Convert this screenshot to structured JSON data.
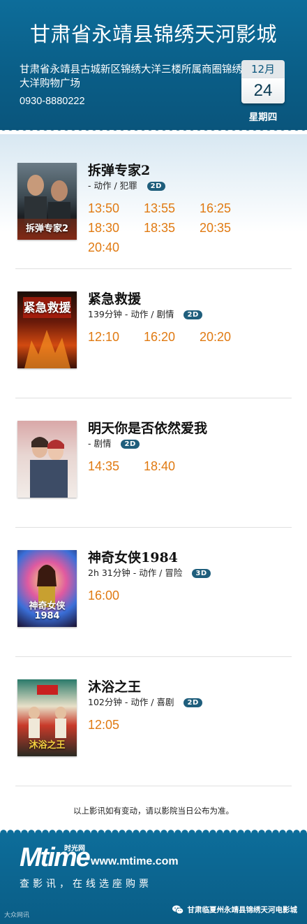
{
  "header": {
    "cinema_name": "甘肃省永靖县锦绣天河影城",
    "address": "甘肃省永靖县古城新区锦绣大洋三楼所属商圈锦绣大洋购物广场",
    "phone": "0930-8880222",
    "date": {
      "month": "12月",
      "day": "24",
      "weekday": "星期四"
    }
  },
  "movies": [
    {
      "name": "拆弹专家2",
      "meta": "- 动作 / 犯罪",
      "format": "2D",
      "poster_text": "拆弹专家2",
      "showtimes": [
        "13:50",
        "13:55",
        "16:25",
        "18:30",
        "18:35",
        "20:35",
        "20:40"
      ]
    },
    {
      "name": "紧急救援",
      "meta": "139分钟 - 动作 / 剧情",
      "format": "2D",
      "poster_text": "紧急救援",
      "showtimes": [
        "12:10",
        "16:20",
        "20:20"
      ]
    },
    {
      "name": "明天你是否依然爱我",
      "meta": "- 剧情",
      "format": "2D",
      "poster_text": "",
      "showtimes": [
        "14:35",
        "18:40"
      ]
    },
    {
      "name": "神奇女侠1984",
      "meta": "2h 31分钟 - 动作 / 冒险",
      "format": "3D",
      "poster_text": "神奇女侠 1984",
      "showtimes": [
        "16:00"
      ]
    },
    {
      "name": "沐浴之王",
      "meta": "102分钟 - 动作 / 喜剧",
      "format": "2D",
      "poster_text": "沐浴之王",
      "showtimes": [
        "12:05"
      ]
    }
  ],
  "notice": "以上影讯如有变动，请以影院当日公布为准。",
  "footer": {
    "logo": "Mtime",
    "logo_cn": "时光网",
    "url": "www.mtime.com",
    "slogan": "查影讯，在线选座购票",
    "wechat_account": "甘肃临夏州永靖县锦绣天河电影城",
    "watermark": "大众网讯"
  },
  "colors": {
    "header_blue": "#0a5d86",
    "showtime_orange": "#e07a12",
    "badge_blue": "#1f5e7c"
  }
}
